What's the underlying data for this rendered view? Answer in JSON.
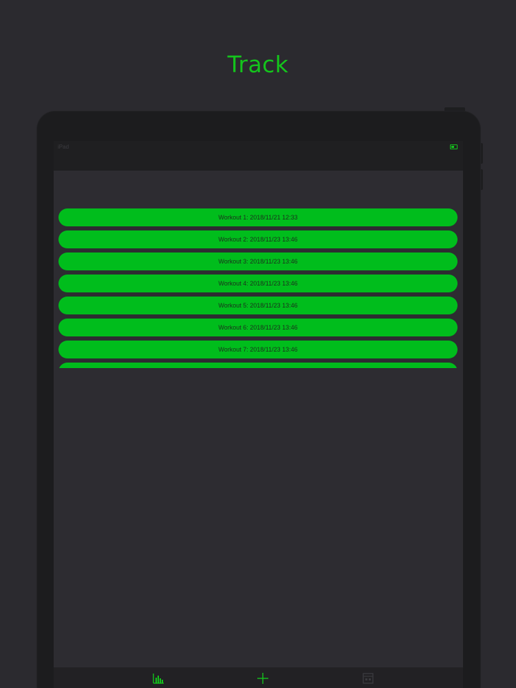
{
  "headline": "Track",
  "status_bar": {
    "left_text": "iPad ",
    "right_text": "",
    "battery_color": "#14c41c"
  },
  "workouts": [
    "Workout 1: 2018/11/21 12:33",
    "Workout 2: 2018/11/23 13:46",
    "Workout 3: 2018/11/23 13:46",
    "Workout 4: 2018/11/23 13:46",
    "Workout 5: 2018/11/23 13:46",
    "Workout 6: 2018/11/23 13:46",
    "Workout 7: 2018/11/23 13:46",
    ""
  ],
  "tab_bar": {
    "tabs": [
      {
        "icon": "bar-chart-icon",
        "color": "#14c41c"
      },
      {
        "icon": "plus-icon",
        "color": "#14c41c"
      },
      {
        "icon": "calendar-icon",
        "color": "#3a3a3e"
      }
    ]
  },
  "colors": {
    "accent": "#14c41c",
    "item_background": "#00bd1c",
    "background": "#2b2a2f"
  }
}
